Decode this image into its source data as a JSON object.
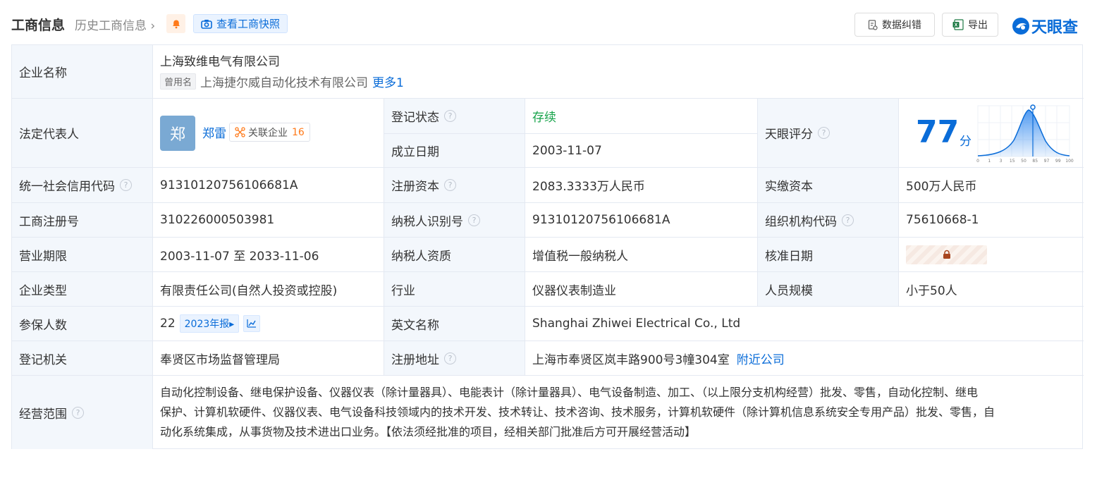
{
  "header": {
    "title": "工商信息",
    "history_link": "历史工商信息 ›",
    "snapshot_button": "查看工商快照",
    "correction_button": "数据纠错",
    "export_button": "导出",
    "logo": "天眼查"
  },
  "company": {
    "name_label": "企业名称",
    "name": "上海致维电气有限公司",
    "former_tag": "曾用名",
    "former_name": "上海捷尔威自动化技术有限公司",
    "more_link": "更多1"
  },
  "legal_rep": {
    "label": "法定代表人",
    "avatar_char": "郑",
    "name": "郑雷",
    "related_label": "关联企业",
    "related_count": "16"
  },
  "status": {
    "label": "登记状态",
    "value": "存续"
  },
  "founded": {
    "label": "成立日期",
    "value": "2003-11-07"
  },
  "score": {
    "label": "天眼评分",
    "value": "77",
    "unit": "分",
    "axis_ticks": [
      "0",
      "1",
      "3",
      "15",
      "50",
      "85",
      "97",
      "99",
      "100"
    ],
    "marker_position": 0.6
  },
  "rows": {
    "credit_code": {
      "label": "统一社会信用代码",
      "value": "91310120756106681A"
    },
    "reg_capital": {
      "label": "注册资本",
      "value": "2083.3333万人民币"
    },
    "paid_capital": {
      "label": "实缴资本",
      "value": "500万人民币"
    },
    "reg_number": {
      "label": "工商注册号",
      "value": "310226000503981"
    },
    "taxpayer_id": {
      "label": "纳税人识别号",
      "value": "91310120756106681A"
    },
    "org_code": {
      "label": "组织机构代码",
      "value": "75610668-1"
    },
    "term": {
      "label": "营业期限",
      "value": "2003-11-07 至 2033-11-06"
    },
    "taxpayer_type": {
      "label": "纳税人资质",
      "value": "增值税一般纳税人"
    },
    "approval_date": {
      "label": "核准日期"
    },
    "company_type": {
      "label": "企业类型",
      "value": "有限责任公司(自然人投资或控股)"
    },
    "industry": {
      "label": "行业",
      "value": "仪器仪表制造业"
    },
    "staff_size": {
      "label": "人员规模",
      "value": "小于50人"
    },
    "insured": {
      "label": "参保人数",
      "value": "22",
      "report_tag": "2023年报▸"
    },
    "english_name": {
      "label": "英文名称",
      "value": "Shanghai Zhiwei Electrical Co., Ltd"
    },
    "authority": {
      "label": "登记机关",
      "value": "奉贤区市场监督管理局"
    },
    "address": {
      "label": "注册地址",
      "value": "上海市奉贤区岚丰路900号3幢304室",
      "nearby_link": "附近公司"
    },
    "scope": {
      "label": "经营范围",
      "line1": "自动化控制设备、继电保护设备、仪器仪表（除计量器具）、电能表计（除计量器具）、电气设备制造、加工、（以上限分支机构经营）批发、零售，自动化控制、继电",
      "line2": "保护、计算机软硬件、仪器仪表、电气设备科技领域内的技术开发、技术转让、技术咨询、技术服务，计算机软硬件（除计算机信息系统安全专用产品）批发、零售，自",
      "line3": "动化系统集成，从事货物及技术进出口业务。【依法须经批准的项目，经相关部门批准后方可开展经营活动】"
    }
  }
}
